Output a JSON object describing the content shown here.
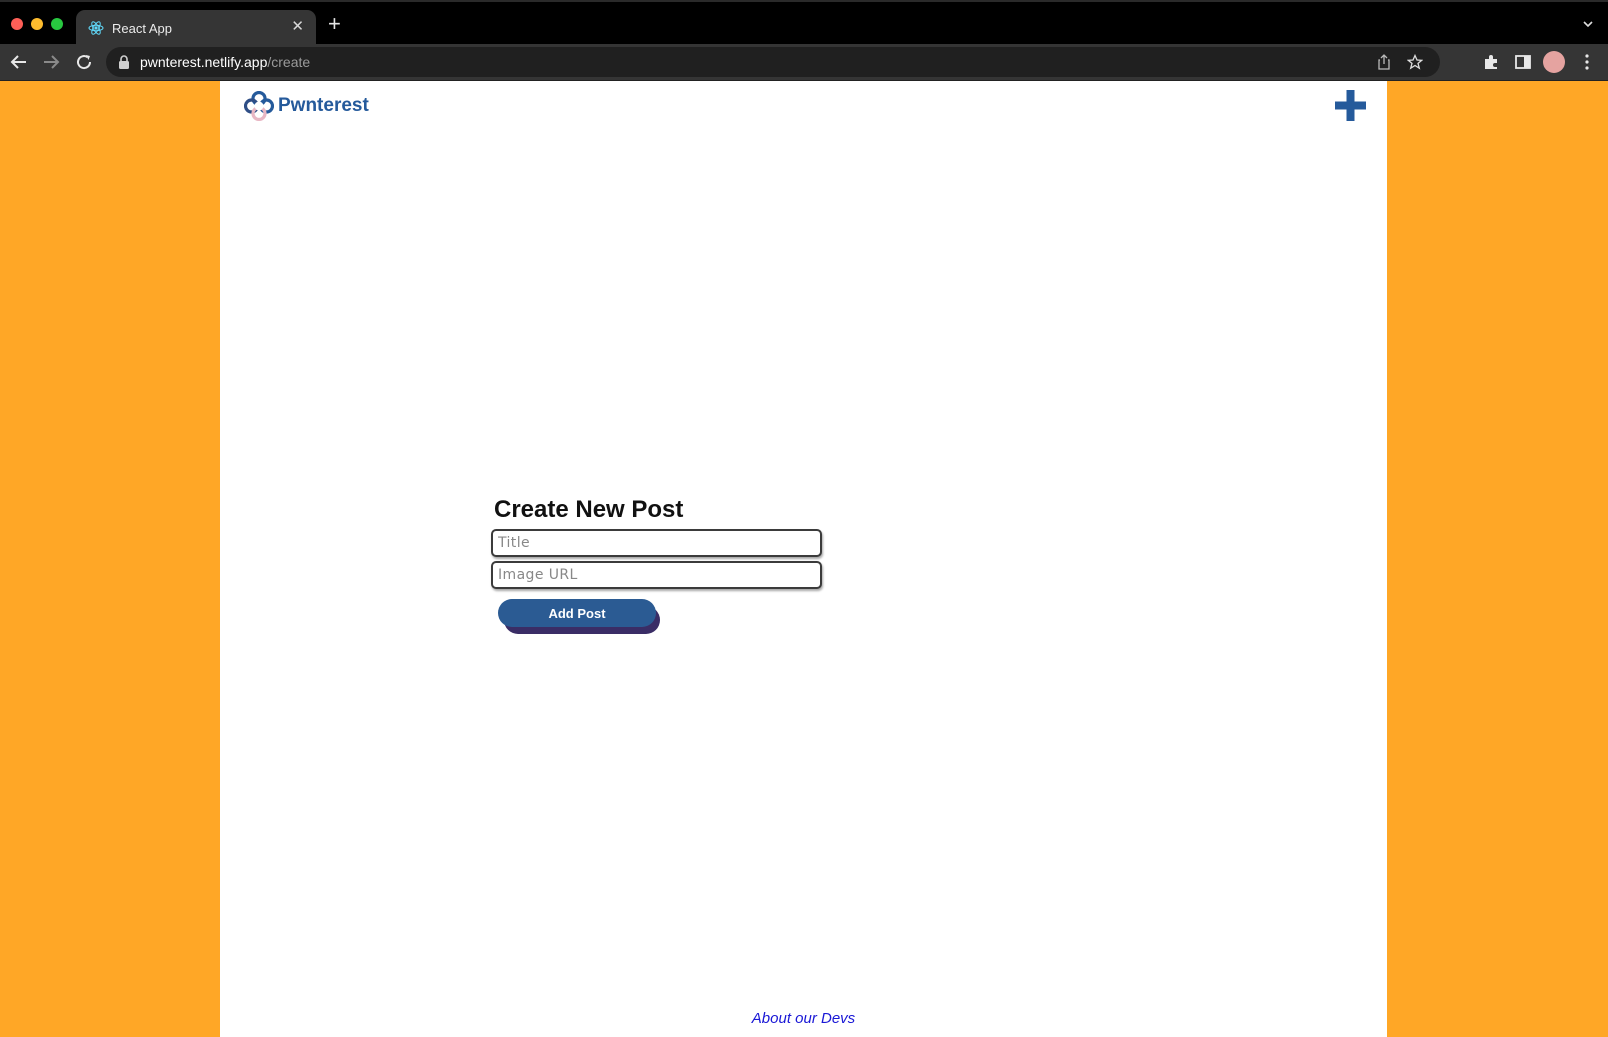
{
  "browser": {
    "tab_title": "React App",
    "url_host": "pwnterest.netlify.app",
    "url_path": "/create"
  },
  "site": {
    "brand": "Pwnterest",
    "colors": {
      "background": "#ffa726",
      "brand_blue": "#255a9b",
      "button": "#2b5b93",
      "button_shadow": "#3a2d66",
      "footer_link": "#1a18d6"
    }
  },
  "form": {
    "heading": "Create New Post",
    "title_placeholder": "Title",
    "title_value": "",
    "image_url_placeholder": "Image URL",
    "image_url_value": "",
    "submit_label": "Add Post"
  },
  "footer": {
    "link_label": "About our Devs"
  }
}
